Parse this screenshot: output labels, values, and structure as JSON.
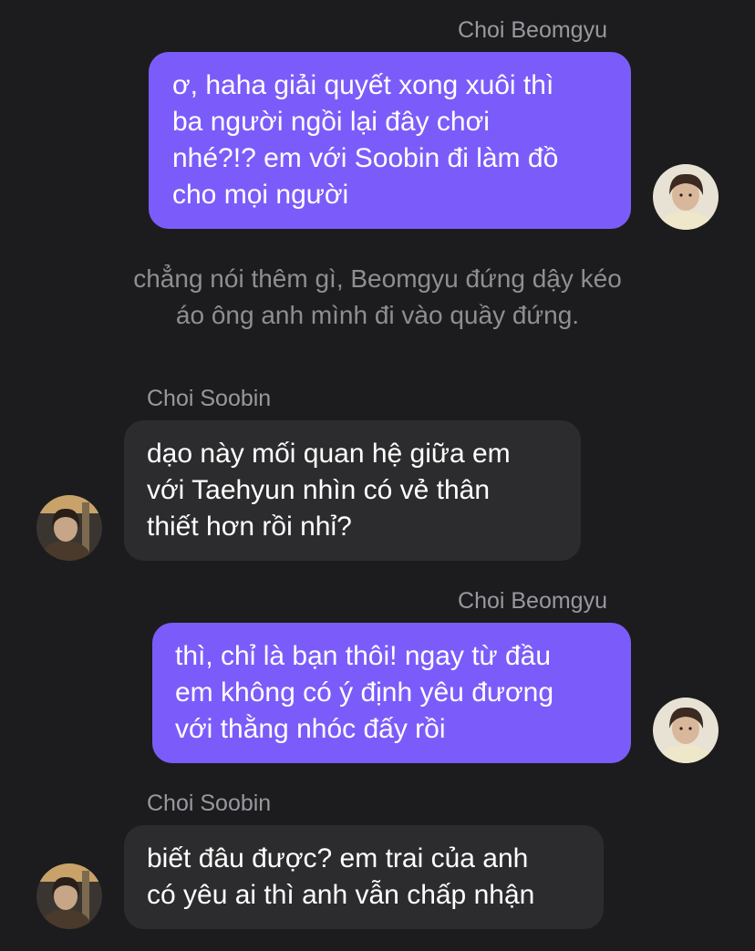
{
  "messages": [
    {
      "sender": "Choi Beomgyu",
      "lines": [
        "ơ, haha giải quyết xong xuôi thì",
        "ba người ngồi lại đây chơi",
        "nhé?!? em với Soobin đi làm đồ",
        "cho mọi người"
      ]
    },
    {
      "sender": "Choi Soobin",
      "lines": [
        "dạo này mối quan hệ giữa em",
        "với Taehyun nhìn có vẻ thân",
        "thiết hơn rồi nhỉ?"
      ]
    },
    {
      "sender": "Choi Beomgyu",
      "lines": [
        "thì, chỉ là bạn thôi! ngay từ đầu",
        "em không có ý định yêu đương",
        "với thằng nhóc đấy rồi"
      ]
    },
    {
      "sender": "Choi Soobin",
      "lines": [
        "biết đâu được? em trai của anh",
        "có yêu ai thì anh vẫn chấp nhận"
      ]
    }
  ],
  "narration": {
    "lines": [
      "chẳng nói thêm gì, Beomgyu đứng dậy kéo",
      "áo ông anh mình đi vào quầy đứng."
    ]
  },
  "colors": {
    "background": "#1c1c1e",
    "outgoing_bubble": "#7b5cfa",
    "incoming_bubble": "#2c2c2e",
    "sender_name": "#98989f",
    "narration": "#8e8e93"
  },
  "avatars": {
    "beomgyu": "avatar-photo-light",
    "soobin": "avatar-photo-dark"
  }
}
